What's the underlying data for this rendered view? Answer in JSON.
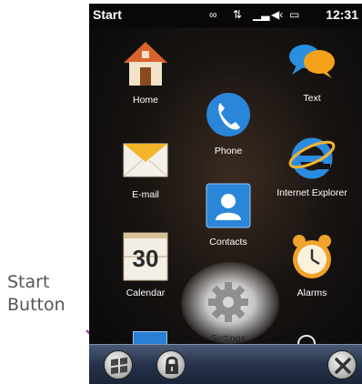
{
  "annotation": {
    "line1": "Start",
    "line2": "Button"
  },
  "status_bar": {
    "title": "Start",
    "time": "12:31"
  },
  "apps": [
    {
      "label": "Home",
      "icon": "house-icon"
    },
    {
      "label": "Text",
      "icon": "chat-bubbles-icon"
    },
    {
      "label": "Phone",
      "icon": "phone-icon"
    },
    {
      "label": "E-mail",
      "icon": "envelope-icon"
    },
    {
      "label": "Internet Explorer",
      "icon": "internet-explorer-icon"
    },
    {
      "label": "Contacts",
      "icon": "contacts-icon"
    },
    {
      "label": "Calendar",
      "icon": "calendar-icon",
      "day": "30"
    },
    {
      "label": "Alarms",
      "icon": "alarm-clock-icon"
    },
    {
      "label": "Settings",
      "icon": "gear-icon"
    }
  ],
  "colors": {
    "accent_blue": "#1e7fd6",
    "highlight_glow": "#ffffff",
    "taskbar": "#26324a"
  }
}
